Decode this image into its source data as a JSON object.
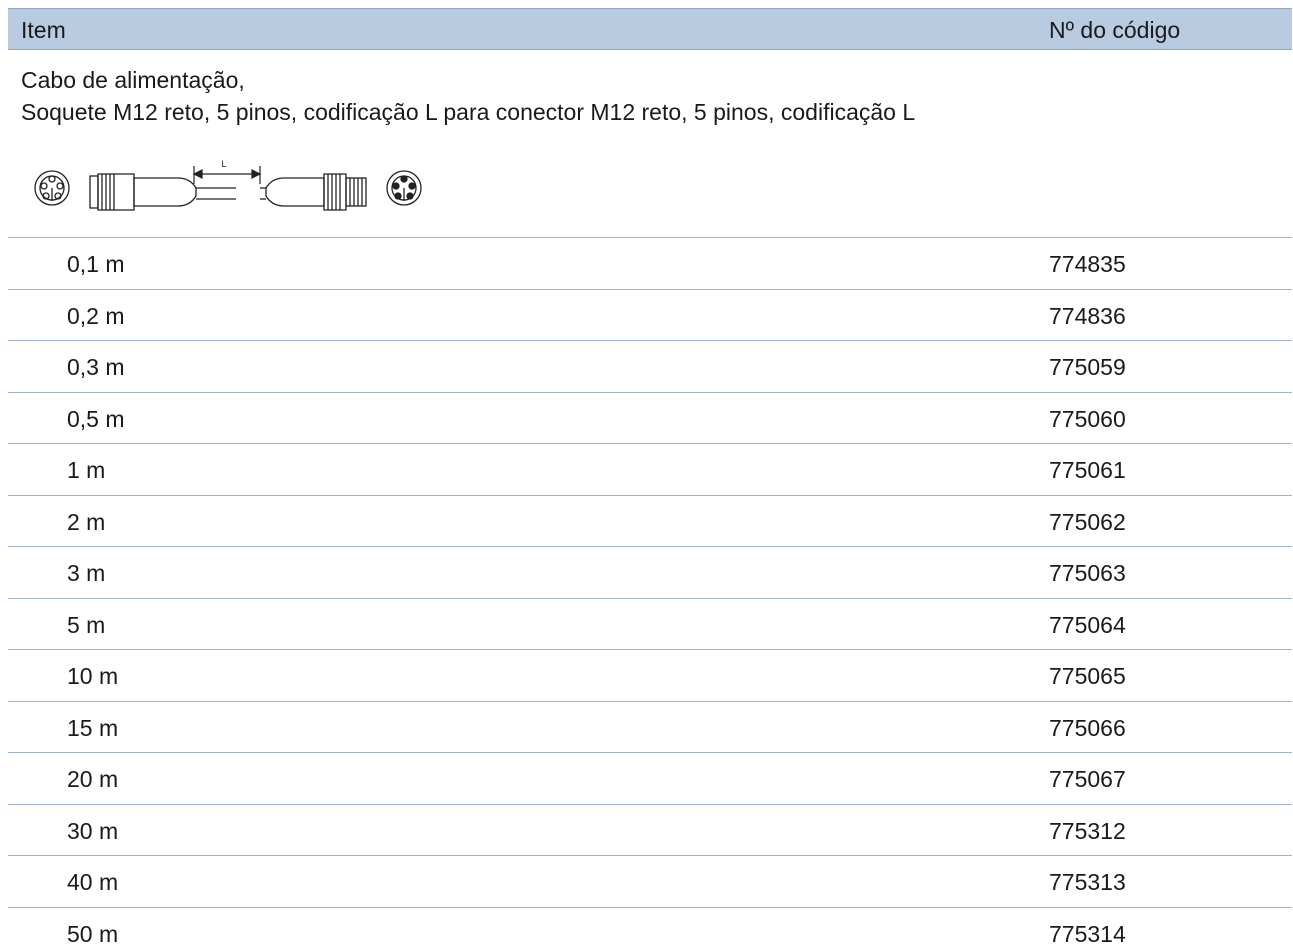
{
  "table": {
    "header": {
      "item": "Item",
      "code": "Nº do código"
    },
    "description": {
      "line1": "Cabo de alimentação,",
      "line2": "Soquete M12 reto, 5 pinos, codificação L para conector M12 reto, 5 pinos, codificação L"
    },
    "diagram": {
      "dimension_label": "L",
      "icon": "m12-cable-drawing"
    },
    "rows": [
      {
        "length": "0,1 m",
        "code": "774835"
      },
      {
        "length": "0,2 m",
        "code": "774836"
      },
      {
        "length": "0,3 m",
        "code": "775059"
      },
      {
        "length": "0,5 m",
        "code": "775060"
      },
      {
        "length": "1 m",
        "code": "775061"
      },
      {
        "length": "2 m",
        "code": "775062"
      },
      {
        "length": "3 m",
        "code": "775063"
      },
      {
        "length": "5 m",
        "code": "775064"
      },
      {
        "length": "10 m",
        "code": "775065"
      },
      {
        "length": "15 m",
        "code": "775066"
      },
      {
        "length": "20 m",
        "code": "775067"
      },
      {
        "length": "30 m",
        "code": "775312"
      },
      {
        "length": "40 m",
        "code": "775313"
      },
      {
        "length": "50 m",
        "code": "775314"
      }
    ],
    "colors": {
      "header_bg": "#b9cbe0",
      "row_line": "#9eb3cc"
    }
  }
}
